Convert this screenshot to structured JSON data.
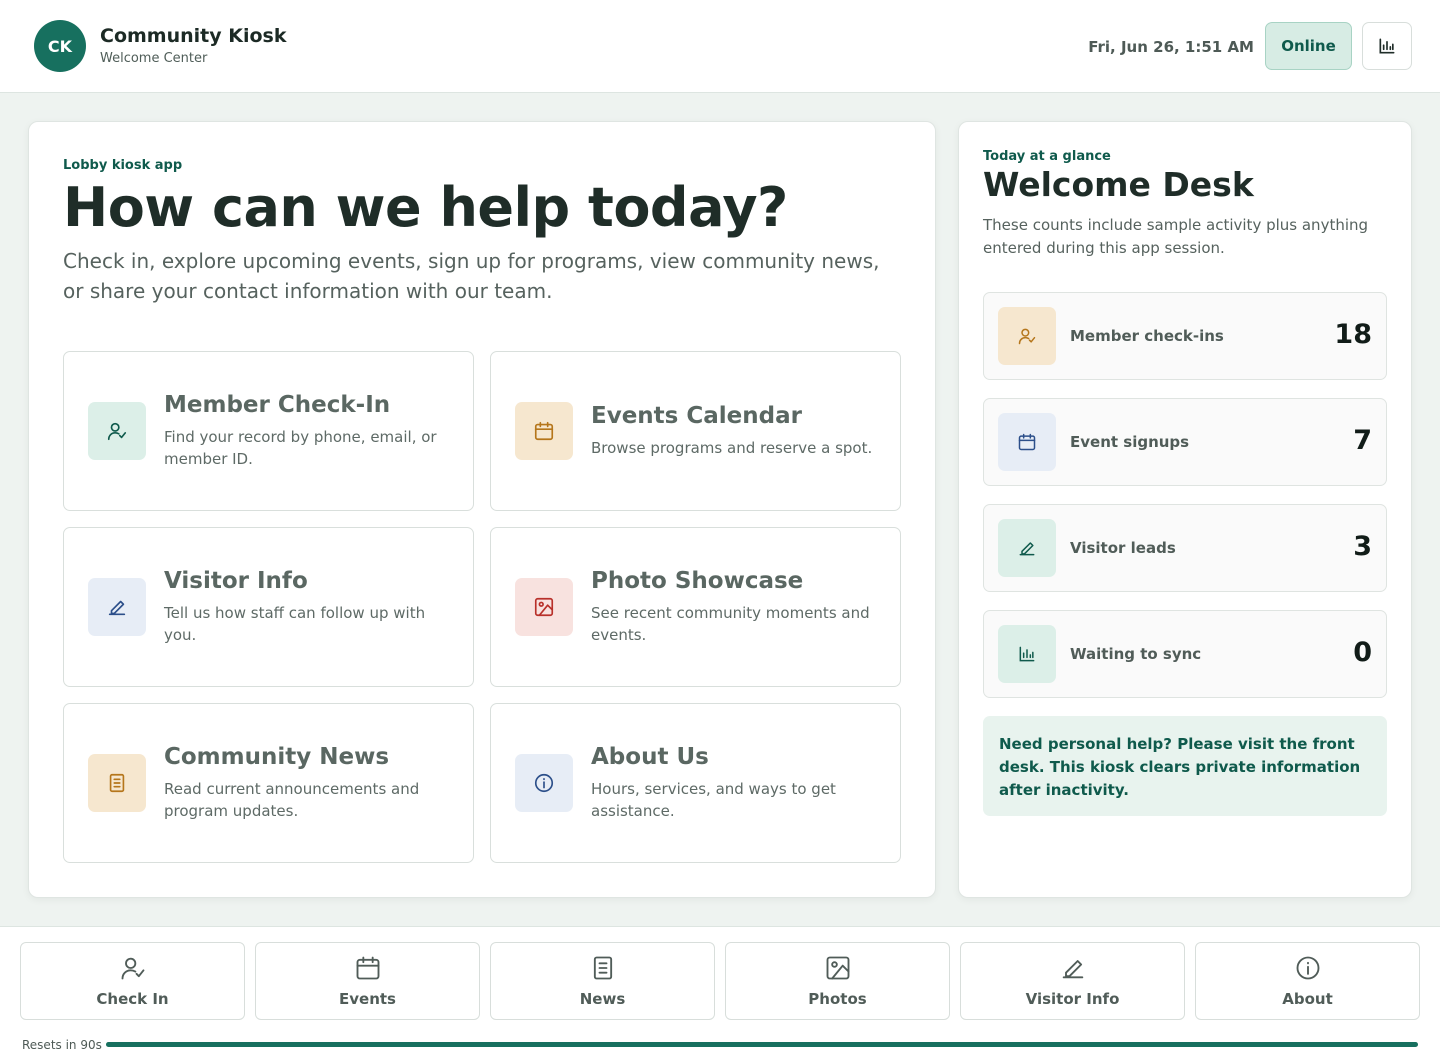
{
  "header": {
    "avatar_initials": "CK",
    "title": "Community Kiosk",
    "subtitle": "Welcome Center",
    "datetime": "Fri, Jun 26, 1:51 AM",
    "status_label": "Online",
    "stats_icon": "bar-chart-icon"
  },
  "hero": {
    "eyebrow": "Lobby kiosk app",
    "headline": "How can we help today?",
    "intro": "Check in, explore upcoming events, sign up for programs, view community news, or share your contact information with our team."
  },
  "tiles": [
    {
      "title": "Member Check-In",
      "desc": "Find your record by phone, email, or member ID.",
      "icon": "user-check-icon",
      "color": "#0f5a4c",
      "bg": "#dcefe8"
    },
    {
      "title": "Events Calendar",
      "desc": "Browse programs and reserve a spot.",
      "icon": "calendar-icon",
      "color": "#b5761b",
      "bg": "#f6e7cf"
    },
    {
      "title": "Visitor Info",
      "desc": "Tell us how staff can follow up with you.",
      "icon": "pencil-icon",
      "color": "#2c4f8a",
      "bg": "#e7edf6"
    },
    {
      "title": "Photo Showcase",
      "desc": "See recent community moments and events.",
      "icon": "image-icon",
      "color": "#b8302a",
      "bg": "#f8e2df"
    },
    {
      "title": "Community News",
      "desc": "Read current announcements and program updates.",
      "icon": "document-icon",
      "color": "#b5761b",
      "bg": "#f6e7cf"
    },
    {
      "title": "About Us",
      "desc": "Hours, services, and ways to get assistance.",
      "icon": "info-icon",
      "color": "#2c4f8a",
      "bg": "#e7edf6"
    }
  ],
  "glance": {
    "eyebrow": "Today at a glance",
    "title": "Welcome Desk",
    "desc": "These counts include sample activity plus anything entered during this app session.",
    "stats": [
      {
        "label": "Member check-ins",
        "value": "18",
        "icon": "user-check-icon"
      },
      {
        "label": "Event signups",
        "value": "7",
        "icon": "calendar-icon"
      },
      {
        "label": "Visitor leads",
        "value": "3",
        "icon": "pencil-icon"
      },
      {
        "label": "Waiting to sync",
        "value": "0",
        "icon": "bar-chart-icon"
      }
    ],
    "help": "Need personal help? Please visit the front desk. This kiosk clears private information after inactivity."
  },
  "nav": [
    {
      "label": "Check In",
      "icon": "user-check-icon"
    },
    {
      "label": "Events",
      "icon": "calendar-icon"
    },
    {
      "label": "News",
      "icon": "document-icon"
    },
    {
      "label": "Photos",
      "icon": "image-icon"
    },
    {
      "label": "Visitor Info",
      "icon": "pencil-icon"
    },
    {
      "label": "About",
      "icon": "info-icon"
    }
  ],
  "reset": {
    "label": "Resets in 90s",
    "progress": 1.0
  }
}
